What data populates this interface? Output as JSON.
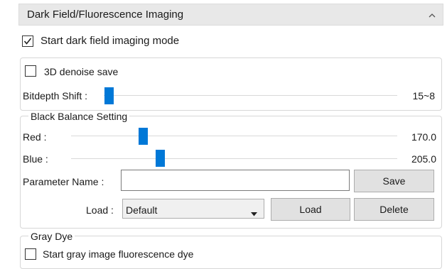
{
  "panel": {
    "title": "Dark Field/Fluorescence Imaging",
    "collapse_icon": "caret-up-icon"
  },
  "dark_field": {
    "label": "Start dark field imaging mode",
    "checked": true
  },
  "denoise_group": {
    "denoise_label": "3D denoise save",
    "denoise_checked": false,
    "bitdepth_label": "Bitdepth Shift :",
    "bitdepth_value": "15~8"
  },
  "black_balance": {
    "title": "Black Balance Setting",
    "red_label": "Red :",
    "red_value": "170.0",
    "blue_label": "Blue :",
    "blue_value": "205.0",
    "param_label": "Parameter Name :",
    "param_value": "",
    "save_label": "Save",
    "load_label_text": "Load :",
    "load_selected": "Default",
    "load_button": "Load",
    "delete_button": "Delete"
  },
  "gray_dye": {
    "title": "Gray Dye",
    "label": "Start gray image fluorescence dye",
    "checked": false
  },
  "colors": {
    "accent": "#0078d7",
    "header_bg": "#e8e8e8",
    "button_bg": "#e1e1e1",
    "group_border": "#d7d7d7"
  }
}
